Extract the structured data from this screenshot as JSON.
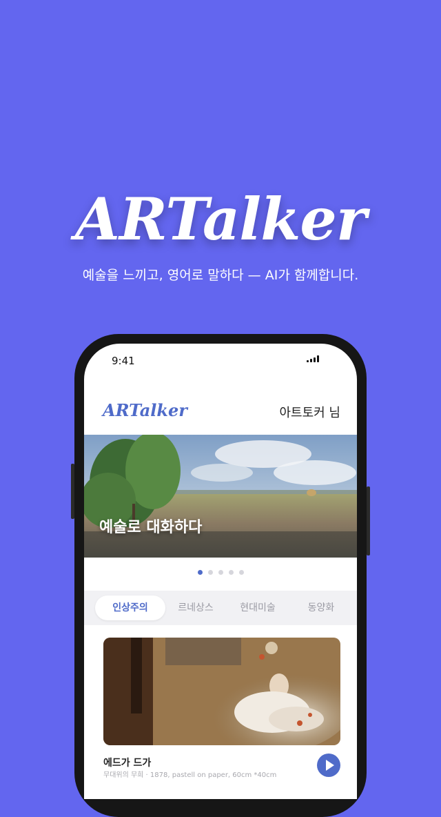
{
  "hero": {
    "logo": "ARTalker",
    "tagline": "예술을 느끼고, 영어로 말하다 — AI가 함께합니다."
  },
  "status_bar": {
    "time": "9:41"
  },
  "app_header": {
    "logo": "ARTalker",
    "user_name": "아트토커 님"
  },
  "banner": {
    "title": "예술로 대화하다",
    "page_count": 5,
    "active_page": 1
  },
  "tabs": [
    {
      "label": "인상주의",
      "active": true
    },
    {
      "label": "르네상스",
      "active": false
    },
    {
      "label": "현대미술",
      "active": false
    },
    {
      "label": "동양화",
      "active": false
    }
  ],
  "artwork": {
    "artist": "에드가 드가",
    "meta": "무대위의 무희 · 1878, pastell on paper, 60cm *40cm"
  },
  "colors": {
    "background": "#6366ef",
    "accent": "#4f6bc9"
  }
}
